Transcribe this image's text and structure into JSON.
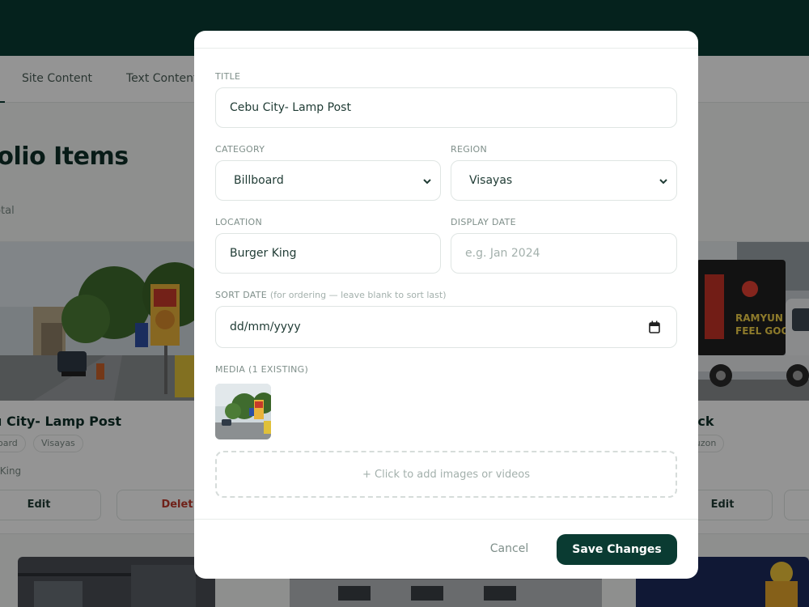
{
  "background": {
    "tabs": [
      "Site Content",
      "Text Content"
    ],
    "page_title": "tfolio Items",
    "page_count": "total",
    "cards": [
      {
        "title": "u City- Lamp Post",
        "chips": [
          "oard",
          "Visayas"
        ],
        "location": "r King",
        "edit": "Edit",
        "delete": "Delet"
      },
      {
        "title": "uck",
        "chips": [
          "Luzon"
        ],
        "edit": "Edit"
      }
    ],
    "billboard_text": "",
    "truck_text": "RAMYUN GOOD, FEEL GOOD."
  },
  "modal": {
    "title_label": "TITLE",
    "title_value": "Cebu City- Lamp Post",
    "category_label": "CATEGORY",
    "category_value": "Billboard",
    "region_label": "REGION",
    "region_value": "Visayas",
    "location_label": "LOCATION",
    "location_value": "Burger King",
    "display_date_label": "DISPLAY DATE",
    "display_date_placeholder": "e.g. Jan 2024",
    "sort_date_label": "SORT DATE",
    "sort_date_hint": "(for ordering — leave blank to sort last)",
    "sort_date_placeholder": "dd/mm/yyyy",
    "media_label": "MEDIA (1 EXISTING)",
    "dropzone_text": "+ Click to add images or videos",
    "cancel_label": "Cancel",
    "save_label": "Save Changes"
  },
  "colors": {
    "brand": "#0a3b32",
    "danger": "#c0392b",
    "muted": "#7f8f8a"
  }
}
